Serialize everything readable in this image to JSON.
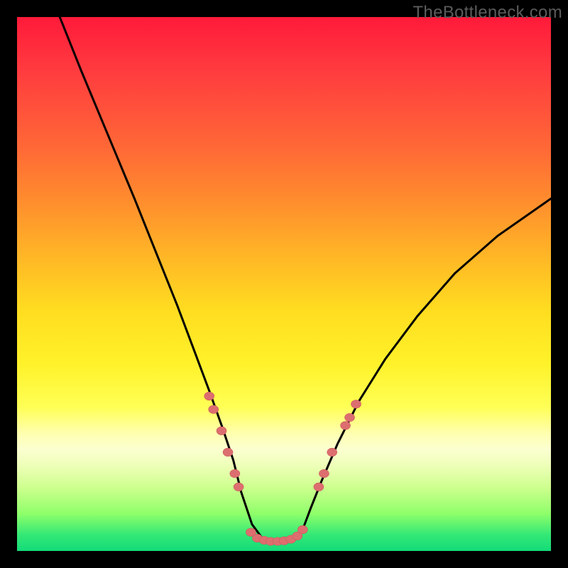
{
  "watermark": "TheBottleneck.com",
  "colors": {
    "background": "#000000",
    "curve_stroke": "#000000",
    "marker_fill": "#dd6e6f",
    "marker_stroke": "#c95a5c"
  },
  "chart_data": {
    "type": "line",
    "title": "",
    "xlabel": "",
    "ylabel": "",
    "xlim": [
      0,
      100
    ],
    "ylim": [
      0,
      100
    ],
    "grid": false,
    "legend": false,
    "series": [
      {
        "name": "bottleneck-curve",
        "comment": "V-shaped curve: steep descent on left, flat trough ~x 44–53, gentler rise on right",
        "x": [
          8,
          12,
          17,
          22,
          26,
          30,
          33,
          36,
          38.5,
          40.5,
          42,
          44,
          46,
          48,
          50,
          52,
          53.5,
          55,
          57,
          60,
          64,
          69,
          75,
          82,
          90,
          100
        ],
        "y": [
          100,
          90,
          78,
          66,
          56,
          46,
          38,
          30,
          23,
          17,
          11,
          5,
          2.3,
          1.8,
          1.8,
          2.3,
          4,
          8,
          13,
          20,
          28,
          36,
          44,
          52,
          59,
          66
        ]
      }
    ],
    "markers": {
      "comment": "Salmon dotted markers overlaid on curve — left cluster, trough cluster, right cluster",
      "points": [
        {
          "x": 36.0,
          "y": 29.0
        },
        {
          "x": 36.8,
          "y": 26.5
        },
        {
          "x": 38.3,
          "y": 22.5
        },
        {
          "x": 39.5,
          "y": 18.5
        },
        {
          "x": 40.8,
          "y": 14.5
        },
        {
          "x": 41.5,
          "y": 12.0
        },
        {
          "x": 43.8,
          "y": 3.5
        },
        {
          "x": 45.0,
          "y": 2.4
        },
        {
          "x": 46.3,
          "y": 2.0
        },
        {
          "x": 47.5,
          "y": 1.8
        },
        {
          "x": 48.8,
          "y": 1.8
        },
        {
          "x": 50.0,
          "y": 1.9
        },
        {
          "x": 51.3,
          "y": 2.2
        },
        {
          "x": 52.5,
          "y": 2.8
        },
        {
          "x": 53.5,
          "y": 4.0
        },
        {
          "x": 56.5,
          "y": 12.0
        },
        {
          "x": 57.5,
          "y": 14.5
        },
        {
          "x": 59.0,
          "y": 18.5
        },
        {
          "x": 61.5,
          "y": 23.5
        },
        {
          "x": 62.3,
          "y": 25.0
        },
        {
          "x": 63.5,
          "y": 27.5
        }
      ],
      "radius": 7
    }
  }
}
